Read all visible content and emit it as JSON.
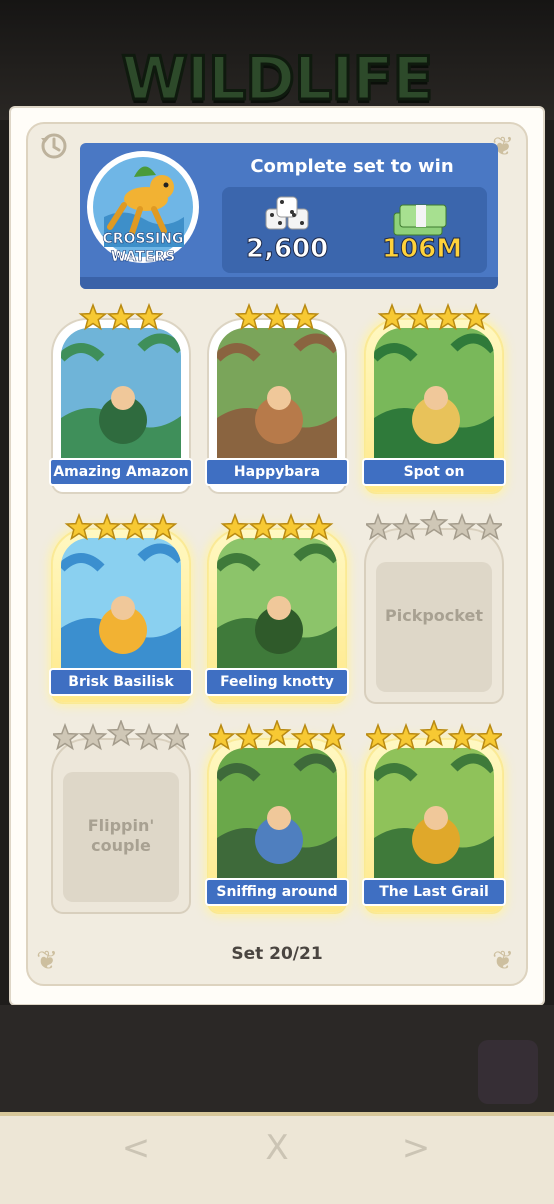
{
  "header": {
    "title": "WILDLIFE"
  },
  "set": {
    "badge_title": "CROSSING WATERS",
    "reward_heading": "Complete set to win",
    "rewards": {
      "dice": "2,600",
      "cash": "106M"
    },
    "progress": "Set 20/21"
  },
  "cards": [
    {
      "name": "Amazing Amazon",
      "stars": 3,
      "collected": true
    },
    {
      "name": "Happybara",
      "stars": 3,
      "collected": true
    },
    {
      "name": "Spot on",
      "stars": 4,
      "collected": true
    },
    {
      "name": "Brisk Basilisk",
      "stars": 4,
      "collected": true
    },
    {
      "name": "Feeling knotty",
      "stars": 4,
      "collected": true
    },
    {
      "name": "Pickpocket",
      "stars": 5,
      "collected": false
    },
    {
      "name": "Flippin' couple",
      "stars": 5,
      "collected": false
    },
    {
      "name": "Sniffing around",
      "stars": 5,
      "collected": true
    },
    {
      "name": "The Last Grail",
      "stars": 5,
      "collected": true
    }
  ],
  "nav": {
    "prev": "<",
    "close": "X",
    "next": ">"
  },
  "icons": {
    "history": "history-icon",
    "dice": "dice-icon",
    "cash": "cash-stack-icon",
    "star": "star-icon",
    "badge": "basilisk-badge-icon",
    "chest": "treasure-chest-icon"
  },
  "colors": {
    "banner": "#4a78c4",
    "label": "#3f6fc2",
    "star": "#f7c933"
  }
}
